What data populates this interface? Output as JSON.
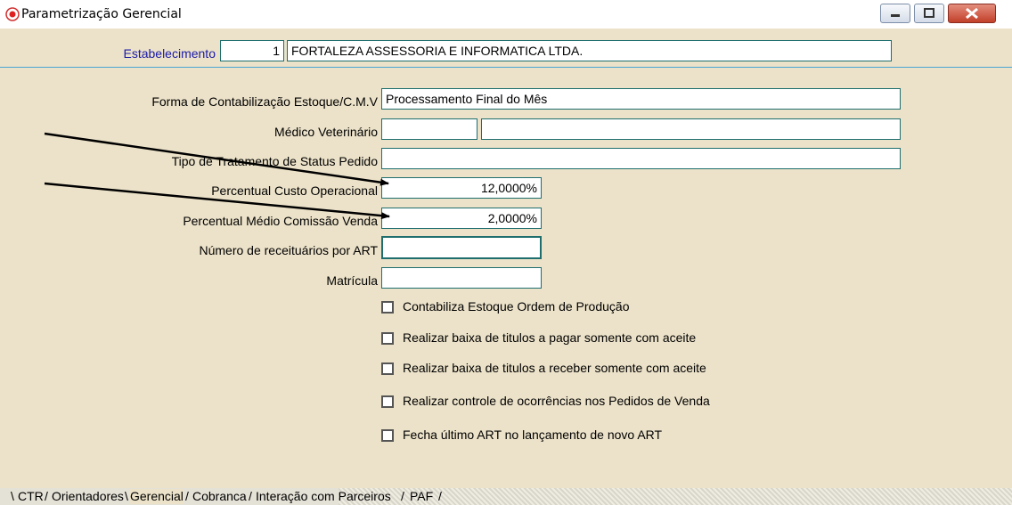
{
  "window": {
    "title": "Parametrização Gerencial",
    "controls": [
      "minimize-icon",
      "maximize-icon",
      "close-icon"
    ],
    "colors": {
      "background": "#ece2c9",
      "field_border": "#1e6e6e",
      "label_blue": "#1a1aa6",
      "separator": "#4aa6d4"
    }
  },
  "estabelecimento": {
    "label": "Estabelecimento",
    "code": "1",
    "name": "FORTALEZA ASSESSORIA E INFORMATICA LTDA."
  },
  "form": {
    "forma_contabilizacao": {
      "label": "Forma de Contabilização Estoque/C.M.V",
      "value": "Processamento Final do Mês"
    },
    "medico_veterinario": {
      "label": "Médico Veterinário",
      "code": "",
      "name": ""
    },
    "tipo_tratamento": {
      "label": "Tipo de Tratamento de Status Pedido",
      "value": ""
    },
    "percentual_custo": {
      "label": "Percentual Custo Operacional",
      "value": "12,0000%"
    },
    "percentual_comissao": {
      "label": "Percentual Médio Comissão Venda",
      "value": "2,0000%"
    },
    "numero_receituarios": {
      "label": "Número de receituários por ART",
      "value": ""
    },
    "matricula": {
      "label": "Matrícula",
      "value": ""
    }
  },
  "checkboxes": [
    {
      "label": "Contabiliza Estoque Ordem de Produção",
      "checked": false
    },
    {
      "label": "Realizar baixa de titulos a pagar somente com aceite",
      "checked": false
    },
    {
      "label": "Realizar baixa de titulos a receber somente com aceite",
      "checked": false
    },
    {
      "label": "Realizar controle de ocorrências nos Pedidos de Venda",
      "checked": false
    },
    {
      "label": "Fecha último ART no lançamento de novo ART",
      "checked": false
    }
  ],
  "tabs": [
    {
      "label": "CTR"
    },
    {
      "label": "Orientadores"
    },
    {
      "label": "Gerencial",
      "active": true
    },
    {
      "label": "Cobranca"
    },
    {
      "label": "Interação com Parceiros"
    },
    {
      "label": "PAF"
    }
  ]
}
